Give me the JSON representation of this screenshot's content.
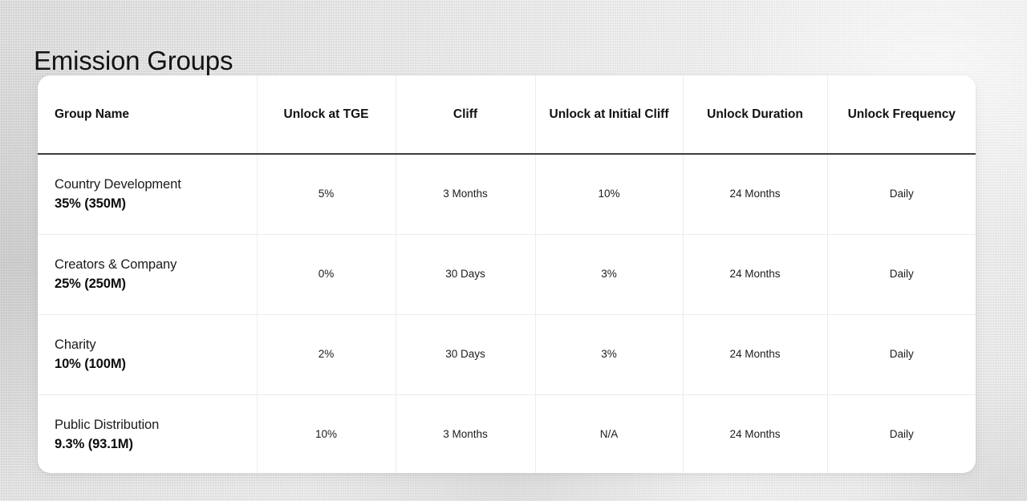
{
  "page": {
    "title": "Emission Groups",
    "background_color": "#e6e6e6",
    "card_background": "#ffffff",
    "header_rule_color": "#3d3d3d",
    "grid_line_color": "#ececec",
    "text_color": "#111111"
  },
  "table": {
    "columns": [
      "Group Name",
      "Unlock at TGE",
      "Cliff",
      "Unlock at Initial Cliff",
      "Unlock Duration",
      "Unlock Frequency"
    ],
    "rows": [
      {
        "group_name": "Country Development",
        "allocation": "35% (350M)",
        "unlock_at_tge": "5%",
        "cliff": "3 Months",
        "unlock_at_initial_cliff": "10%",
        "unlock_duration": "24 Months",
        "unlock_frequency": "Daily"
      },
      {
        "group_name": "Creators & Company",
        "allocation": "25% (250M)",
        "unlock_at_tge": "0%",
        "cliff": "30 Days",
        "unlock_at_initial_cliff": "3%",
        "unlock_duration": "24 Months",
        "unlock_frequency": "Daily"
      },
      {
        "group_name": "Charity",
        "allocation": "10% (100M)",
        "unlock_at_tge": "2%",
        "cliff": "30 Days",
        "unlock_at_initial_cliff": "3%",
        "unlock_duration": "24 Months",
        "unlock_frequency": "Daily"
      },
      {
        "group_name": "Public Distribution",
        "allocation": "9.3% (93.1M)",
        "unlock_at_tge": "10%",
        "cliff": "3 Months",
        "unlock_at_initial_cliff": "N/A",
        "unlock_duration": "24 Months",
        "unlock_frequency": "Daily"
      }
    ]
  }
}
